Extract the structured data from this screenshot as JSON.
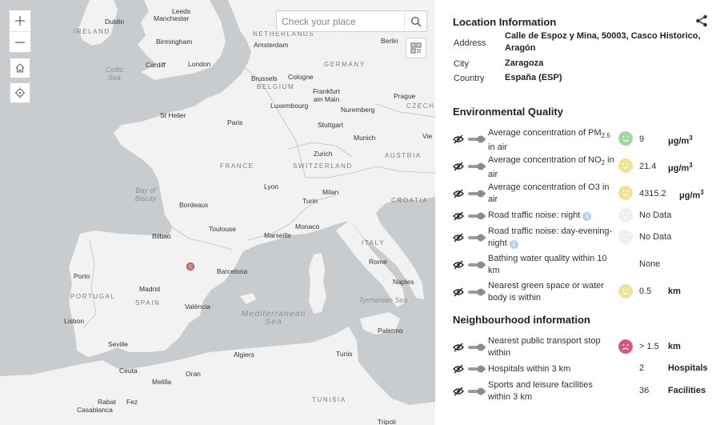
{
  "map": {
    "search_placeholder": "Check your place",
    "labels": {
      "leeds": "Leeds",
      "dublin": "Dublin",
      "manchester": "Manchester",
      "ireland": "IRELAND",
      "birmingham": "Birmingham",
      "netherlands": "NETHERLANDS",
      "amsterdam": "Amsterdam",
      "berlin": "Berlin",
      "celtic_sea": "Celtic Sea",
      "cardiff": "Cardiff",
      "london": "London",
      "germany": "GERMANY",
      "brussels": "Brussels",
      "cologne": "Cologne",
      "belgium": "BELGIUM",
      "frankfurt": "Frankfurt am Main",
      "prague": "Prague",
      "luxembourg": "Luxembourg",
      "nuremberg": "Nuremberg",
      "czechia": "CZECHI",
      "st_helier": "St Helier",
      "paris": "Paris",
      "stuttgart": "Stuttgart",
      "munich": "Munich",
      "vienna": "Vie",
      "france": "FRANCE",
      "zurich": "Zurich",
      "switzerland": "SWITZERLAND",
      "austria": "AUSTRIA",
      "bay_of_biscay": "Bay of Biscay",
      "lyon": "Lyon",
      "milan": "Milan",
      "croatia": "CROATIA",
      "bordeaux": "Bordeaux",
      "turin": "Turin",
      "toulouse": "Toulouse",
      "monaco": "Monaco",
      "marseille": "Marseille",
      "bilbao": "Bilbao",
      "italy": "ITALY",
      "porto": "Porto",
      "barcelona": "Barcelona",
      "rome": "Rome",
      "madrid": "Madrid",
      "naples": "Naples",
      "portugal": "PORTUGAL",
      "spain": "SPAIN",
      "valencia": "València",
      "tyrrhenian_sea": "Tyrrhenian Sea",
      "lisbon": "Lisbon",
      "mediterranean_sea": "Mediterranean Sea",
      "palermo": "Palermo",
      "seville": "Seville",
      "algiers": "Algiers",
      "tunis": "Tunis",
      "ceuta": "Ceuta",
      "oran": "Oran",
      "melilla": "Melilla",
      "rabat": "Rabat",
      "fez": "Fez",
      "casablanca": "Casablanca",
      "tunisia": "TUNISIA",
      "tripoli": "Tripoli"
    },
    "icons": {
      "zoom_in": "plus-icon",
      "zoom_out": "minus-icon",
      "home": "home-icon",
      "locate": "crosshair-icon",
      "search": "search-icon",
      "qr": "qr-code-icon"
    },
    "colors": {
      "land": "#f2f2f2",
      "water": "#c9ccce",
      "marker": "#e07f7f"
    }
  },
  "location": {
    "title": "Location Information",
    "address_label": "Address",
    "address_value": "Calle de Espoz y Mina, 50003, Casco Historico, Aragón",
    "city_label": "City",
    "city_value": "Zaragoza",
    "country_label": "Country",
    "country_value": "España (ESP)"
  },
  "environmental": {
    "title": "Environmental Quality",
    "rows": [
      {
        "desc_pre": "Average concentration of PM",
        "desc_sub": "2.5",
        "desc_post": " in air",
        "value": "9",
        "unit_base": "μg/m",
        "unit_sup": "3",
        "face": "good"
      },
      {
        "desc_pre": "Average concentration of NO",
        "desc_sub": "2",
        "desc_post": " in air",
        "value": "21.4",
        "unit_base": "μg/m",
        "unit_sup": "3",
        "face": "fair"
      },
      {
        "desc_pre": "Average concentration of O3 in air",
        "desc_sub": "",
        "desc_post": "",
        "value": "4315.2",
        "unit_base": "μg/m",
        "unit_sup": "3",
        "face": "fair"
      },
      {
        "desc_pre": "Road traffic noise: night",
        "desc_sub": "",
        "desc_post": "",
        "value": "No Data",
        "unit_base": "",
        "unit_sup": "",
        "face": "none",
        "info": "i"
      },
      {
        "desc_pre": "Road traffic noise: day-evening-night",
        "desc_sub": "",
        "desc_post": "",
        "value": "No Data",
        "unit_base": "",
        "unit_sup": "",
        "face": "none",
        "info": "i"
      },
      {
        "desc_pre": "Bathing water quality within 10 km",
        "desc_sub": "",
        "desc_post": "",
        "value": "None",
        "unit_base": "",
        "unit_sup": "",
        "face": "hidden"
      },
      {
        "desc_pre": "Nearest green space or water body is within",
        "desc_sub": "",
        "desc_post": "",
        "value": "0.5",
        "unit_base": "km",
        "unit_sup": "",
        "face": "fair"
      }
    ]
  },
  "neighbourhood": {
    "title": "Neighbourhood information",
    "rows": [
      {
        "desc": "Nearest public transport stop within",
        "value": "> 1.5",
        "unit": "km",
        "face": "bad"
      },
      {
        "desc": "Hospitals within 3 km",
        "value": "2",
        "unit": "Hospitals",
        "face": "hidden"
      },
      {
        "desc": "Sports and leisure facilities within 3 km",
        "value": "36",
        "unit": "Facilities",
        "face": "hidden"
      }
    ]
  },
  "face_colors": {
    "good": "#9fd8a3",
    "fair": "#ece394",
    "bad": "#d8567c",
    "none": "#efefef"
  },
  "icons": {
    "share": "share-icon",
    "layer_visibility": "eye-slash-icon",
    "layer_toggle": "toggle-icon",
    "info": "info-icon"
  }
}
